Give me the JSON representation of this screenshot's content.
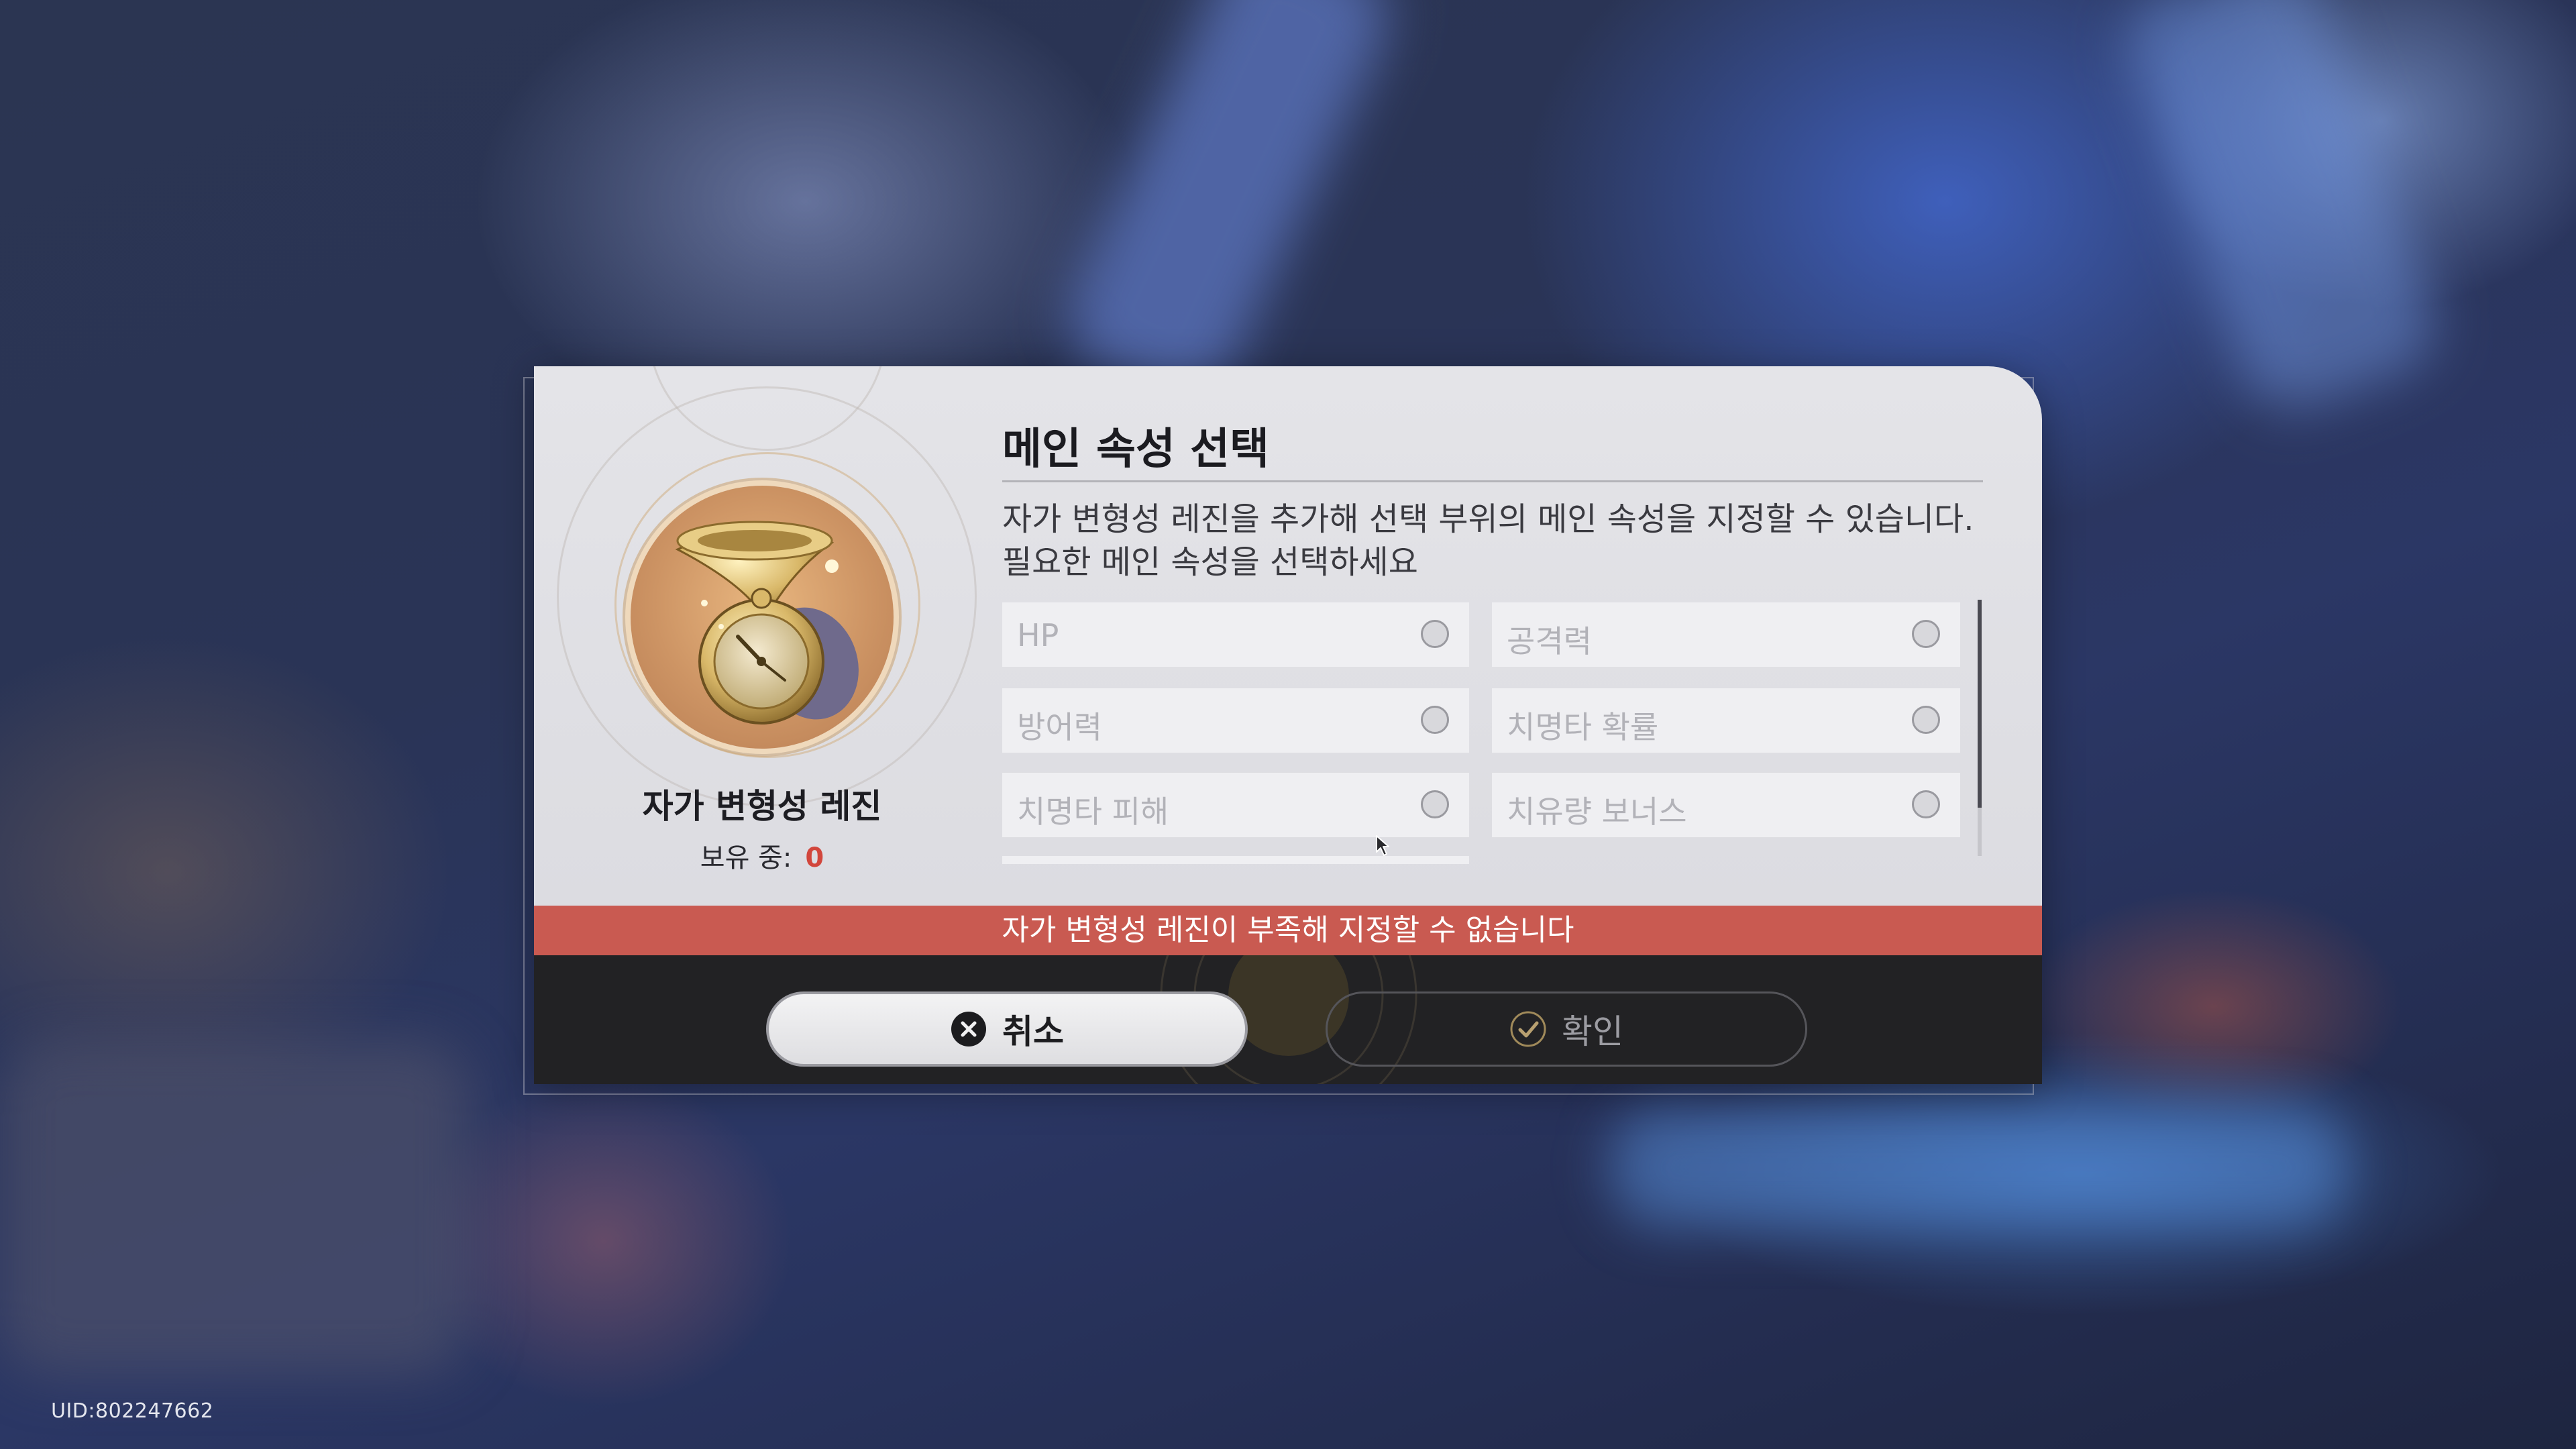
{
  "uid": "UID:802247662",
  "dialog": {
    "title": "메인 속성 선택",
    "description_lines": [
      "자가 변형성 레진을 추가해 선택 부위의 메인 속성을 지정할 수 있습니다.",
      "필요한 메인 속성을 선택하세요"
    ],
    "item": {
      "name": "자가 변형성 레진",
      "owned_label": "보유 중:",
      "owned_count": "0",
      "icon": "resin-pocket-watch-icon"
    },
    "options": [
      {
        "label": "HP",
        "selected": false
      },
      {
        "label": "공격력",
        "selected": false
      },
      {
        "label": "방어력",
        "selected": false
      },
      {
        "label": "치명타 확률",
        "selected": false
      },
      {
        "label": "치명타 피해",
        "selected": false
      },
      {
        "label": "치유량 보너스",
        "selected": false
      }
    ],
    "warning": "자가 변형성 레진이 부족해 지정할 수 없습니다",
    "buttons": {
      "cancel": {
        "label": "취소",
        "icon": "cancel-x-icon"
      },
      "confirm": {
        "label": "확인",
        "icon": "check-icon"
      }
    }
  },
  "colors": {
    "warning_bar": "#c95a51",
    "owned_count": "#d2463c",
    "dialog_bg": "#e2e2e6",
    "footer_bg": "#222224"
  }
}
